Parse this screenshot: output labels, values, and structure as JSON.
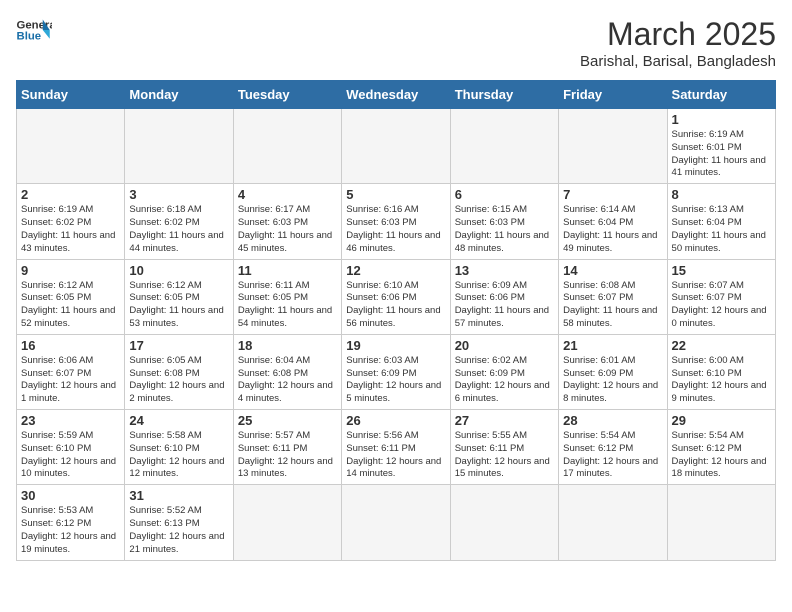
{
  "logo": {
    "line1": "General",
    "line2": "Blue"
  },
  "title": "March 2025",
  "location": "Barishal, Barisal, Bangladesh",
  "days_header": [
    "Sunday",
    "Monday",
    "Tuesday",
    "Wednesday",
    "Thursday",
    "Friday",
    "Saturday"
  ],
  "weeks": [
    [
      {
        "day": "",
        "info": ""
      },
      {
        "day": "",
        "info": ""
      },
      {
        "day": "",
        "info": ""
      },
      {
        "day": "",
        "info": ""
      },
      {
        "day": "",
        "info": ""
      },
      {
        "day": "",
        "info": ""
      },
      {
        "day": "1",
        "info": "Sunrise: 6:19 AM\nSunset: 6:01 PM\nDaylight: 11 hours and 41 minutes."
      }
    ],
    [
      {
        "day": "2",
        "info": "Sunrise: 6:19 AM\nSunset: 6:02 PM\nDaylight: 11 hours and 43 minutes."
      },
      {
        "day": "3",
        "info": "Sunrise: 6:18 AM\nSunset: 6:02 PM\nDaylight: 11 hours and 44 minutes."
      },
      {
        "day": "4",
        "info": "Sunrise: 6:17 AM\nSunset: 6:03 PM\nDaylight: 11 hours and 45 minutes."
      },
      {
        "day": "5",
        "info": "Sunrise: 6:16 AM\nSunset: 6:03 PM\nDaylight: 11 hours and 46 minutes."
      },
      {
        "day": "6",
        "info": "Sunrise: 6:15 AM\nSunset: 6:03 PM\nDaylight: 11 hours and 48 minutes."
      },
      {
        "day": "7",
        "info": "Sunrise: 6:14 AM\nSunset: 6:04 PM\nDaylight: 11 hours and 49 minutes."
      },
      {
        "day": "8",
        "info": "Sunrise: 6:13 AM\nSunset: 6:04 PM\nDaylight: 11 hours and 50 minutes."
      }
    ],
    [
      {
        "day": "9",
        "info": "Sunrise: 6:12 AM\nSunset: 6:05 PM\nDaylight: 11 hours and 52 minutes."
      },
      {
        "day": "10",
        "info": "Sunrise: 6:12 AM\nSunset: 6:05 PM\nDaylight: 11 hours and 53 minutes."
      },
      {
        "day": "11",
        "info": "Sunrise: 6:11 AM\nSunset: 6:05 PM\nDaylight: 11 hours and 54 minutes."
      },
      {
        "day": "12",
        "info": "Sunrise: 6:10 AM\nSunset: 6:06 PM\nDaylight: 11 hours and 56 minutes."
      },
      {
        "day": "13",
        "info": "Sunrise: 6:09 AM\nSunset: 6:06 PM\nDaylight: 11 hours and 57 minutes."
      },
      {
        "day": "14",
        "info": "Sunrise: 6:08 AM\nSunset: 6:07 PM\nDaylight: 11 hours and 58 minutes."
      },
      {
        "day": "15",
        "info": "Sunrise: 6:07 AM\nSunset: 6:07 PM\nDaylight: 12 hours and 0 minutes."
      }
    ],
    [
      {
        "day": "16",
        "info": "Sunrise: 6:06 AM\nSunset: 6:07 PM\nDaylight: 12 hours and 1 minute."
      },
      {
        "day": "17",
        "info": "Sunrise: 6:05 AM\nSunset: 6:08 PM\nDaylight: 12 hours and 2 minutes."
      },
      {
        "day": "18",
        "info": "Sunrise: 6:04 AM\nSunset: 6:08 PM\nDaylight: 12 hours and 4 minutes."
      },
      {
        "day": "19",
        "info": "Sunrise: 6:03 AM\nSunset: 6:09 PM\nDaylight: 12 hours and 5 minutes."
      },
      {
        "day": "20",
        "info": "Sunrise: 6:02 AM\nSunset: 6:09 PM\nDaylight: 12 hours and 6 minutes."
      },
      {
        "day": "21",
        "info": "Sunrise: 6:01 AM\nSunset: 6:09 PM\nDaylight: 12 hours and 8 minutes."
      },
      {
        "day": "22",
        "info": "Sunrise: 6:00 AM\nSunset: 6:10 PM\nDaylight: 12 hours and 9 minutes."
      }
    ],
    [
      {
        "day": "23",
        "info": "Sunrise: 5:59 AM\nSunset: 6:10 PM\nDaylight: 12 hours and 10 minutes."
      },
      {
        "day": "24",
        "info": "Sunrise: 5:58 AM\nSunset: 6:10 PM\nDaylight: 12 hours and 12 minutes."
      },
      {
        "day": "25",
        "info": "Sunrise: 5:57 AM\nSunset: 6:11 PM\nDaylight: 12 hours and 13 minutes."
      },
      {
        "day": "26",
        "info": "Sunrise: 5:56 AM\nSunset: 6:11 PM\nDaylight: 12 hours and 14 minutes."
      },
      {
        "day": "27",
        "info": "Sunrise: 5:55 AM\nSunset: 6:11 PM\nDaylight: 12 hours and 15 minutes."
      },
      {
        "day": "28",
        "info": "Sunrise: 5:54 AM\nSunset: 6:12 PM\nDaylight: 12 hours and 17 minutes."
      },
      {
        "day": "29",
        "info": "Sunrise: 5:54 AM\nSunset: 6:12 PM\nDaylight: 12 hours and 18 minutes."
      }
    ],
    [
      {
        "day": "30",
        "info": "Sunrise: 5:53 AM\nSunset: 6:12 PM\nDaylight: 12 hours and 19 minutes."
      },
      {
        "day": "31",
        "info": "Sunrise: 5:52 AM\nSunset: 6:13 PM\nDaylight: 12 hours and 21 minutes."
      },
      {
        "day": "",
        "info": ""
      },
      {
        "day": "",
        "info": ""
      },
      {
        "day": "",
        "info": ""
      },
      {
        "day": "",
        "info": ""
      },
      {
        "day": "",
        "info": ""
      }
    ]
  ]
}
